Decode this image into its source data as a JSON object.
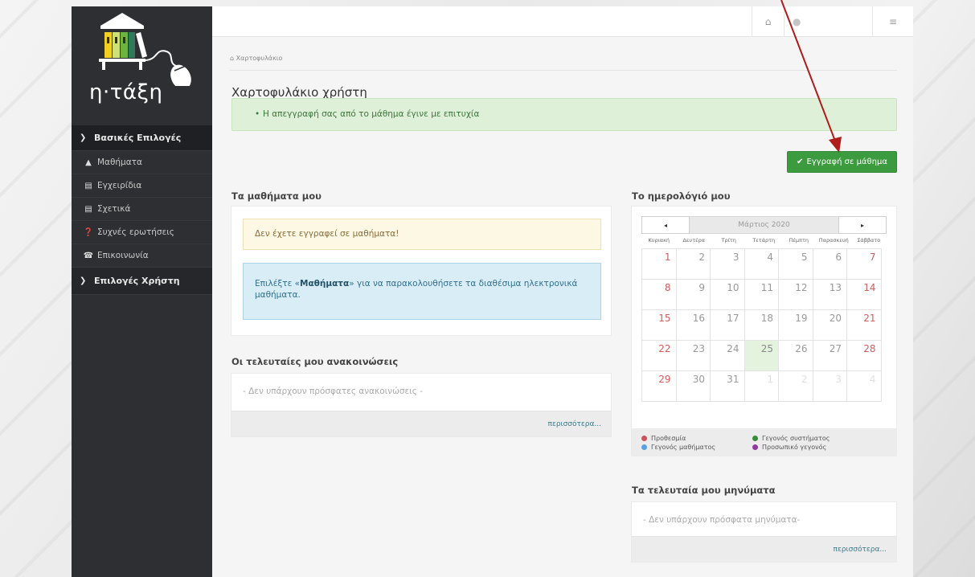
{
  "sidebar": {
    "logo_text": "η·τάξη",
    "section1_label": "Βασικές Επιλογές",
    "items": [
      {
        "label": "Μαθήματα",
        "icon": "graduation-cap-icon"
      },
      {
        "label": "Εγχειρίδια",
        "icon": "file-icon"
      },
      {
        "label": "Σχετικά",
        "icon": "card-icon"
      },
      {
        "label": "Συχνές ερωτήσεις",
        "icon": "question-circle-icon"
      },
      {
        "label": "Επικοινωνία",
        "icon": "phone-icon"
      }
    ],
    "section2_label": "Επιλογές Χρήστη"
  },
  "breadcrumb": "Χαρτοφυλάκιο",
  "page_title": "Χαρτοφυλάκιο χρήστη",
  "success_message": "Η απεγγραφή σας από το μάθημα έγινε με επιτυχία",
  "enroll_button": "Εγγραφή σε μάθημα",
  "my_courses": {
    "title": "Τα μαθήματα μου",
    "warning": "Δεν έχετε εγγραφεί σε μαθήματα!",
    "info_prefix": "Επιλέξτε «",
    "info_bold": "Μαθήματα",
    "info_suffix": "» για να παρακολουθήσετε τα διαθέσιμα ηλεκτρονικά μαθήματα."
  },
  "announcements": {
    "title": "Οι τελευταίες μου ανακοινώσεις",
    "empty": "- Δεν υπάρχουν πρόσφατες ανακοινώσεις -",
    "more": "περισσότερα..."
  },
  "calendar": {
    "title": "Το ημερολόγιό μου",
    "month": "Μάρτιος 2020",
    "prev": "◂",
    "next": "▸",
    "weekdays": [
      "Κυριακή",
      "Δευτέρα",
      "Τρίτη",
      "Τετάρτη",
      "Πέμπτη",
      "Παρασκευή",
      "Σάββατο"
    ],
    "weeks": [
      [
        "1",
        "2",
        "3",
        "4",
        "5",
        "6",
        "7"
      ],
      [
        "8",
        "9",
        "10",
        "11",
        "12",
        "13",
        "14"
      ],
      [
        "15",
        "16",
        "17",
        "18",
        "19",
        "20",
        "21"
      ],
      [
        "22",
        "23",
        "24",
        "25",
        "26",
        "27",
        "28"
      ],
      [
        "29",
        "30",
        "31",
        "1",
        "2",
        "3",
        "4"
      ]
    ],
    "today": "25",
    "legend": [
      {
        "label": "Προθεσμία",
        "color": "#c9545a"
      },
      {
        "label": "Γεγονός συστήματος",
        "color": "#3a8a3a"
      },
      {
        "label": "Γεγονός μαθήματος",
        "color": "#5aa0e0"
      },
      {
        "label": "Προσωπικό γεγονός",
        "color": "#8e3a9c"
      }
    ]
  },
  "messages": {
    "title": "Τα τελευταία μου μηνύματα",
    "empty": "- Δεν υπάρχουν πρόσφατα μηνύματα-",
    "more": "περισσότερα..."
  },
  "colors": {
    "sidebar": "#2e2f33",
    "success": "#3c9a3f",
    "arrow": "#b01c1c"
  }
}
